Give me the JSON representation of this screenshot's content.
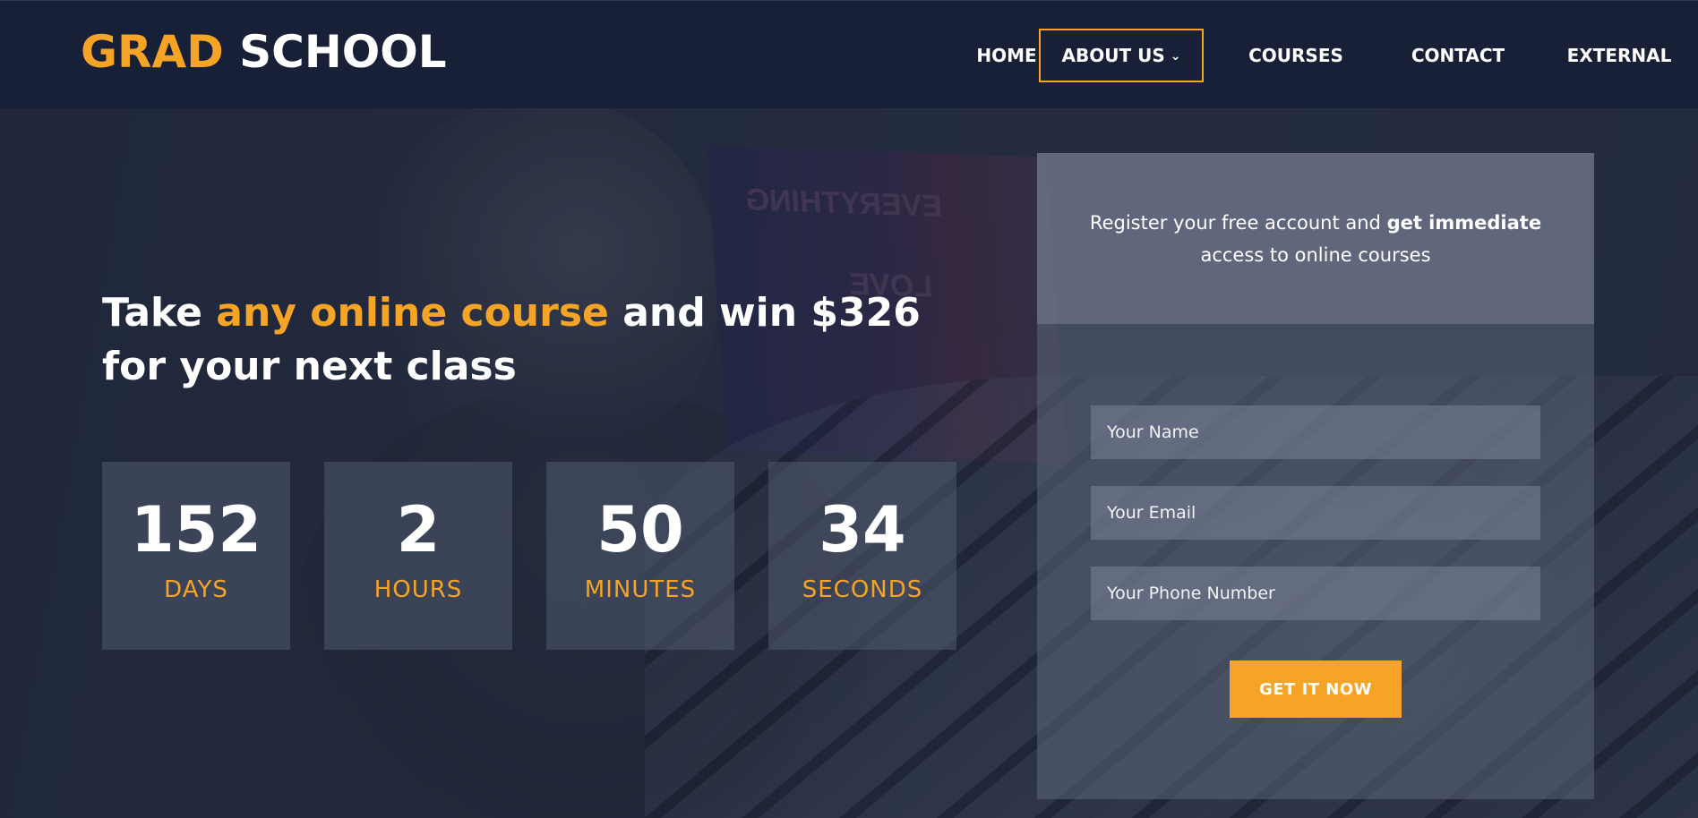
{
  "brand": {
    "part1": "GRAD",
    "part2": "SCHOOL",
    "accent_color": "#f5a425"
  },
  "nav": {
    "items": [
      {
        "label": "HOME"
      },
      {
        "label": "ABOUT US",
        "active": true,
        "has_dropdown": true
      },
      {
        "label": "COURSES"
      },
      {
        "label": "CONTACT"
      },
      {
        "label": "EXTERNAL"
      }
    ]
  },
  "hero": {
    "headline_pre": "Take ",
    "headline_highlight": "any online course",
    "headline_post": " and win $326 for your next class"
  },
  "countdown": [
    {
      "value": "152",
      "label": "DAYS"
    },
    {
      "value": "2",
      "label": "HOURS"
    },
    {
      "value": "50",
      "label": "MINUTES"
    },
    {
      "value": "34",
      "label": "SECONDS"
    }
  ],
  "register": {
    "intro": "Register your free account and ",
    "intro_bold": "get immediate",
    "intro_end": " access to online courses",
    "name_placeholder": "Your Name",
    "email_placeholder": "Your Email",
    "phone_placeholder": "Your Phone Number",
    "submit_label": "GET IT NOW"
  },
  "colors": {
    "header_bg": "#172037",
    "accent": "#f5a425"
  }
}
